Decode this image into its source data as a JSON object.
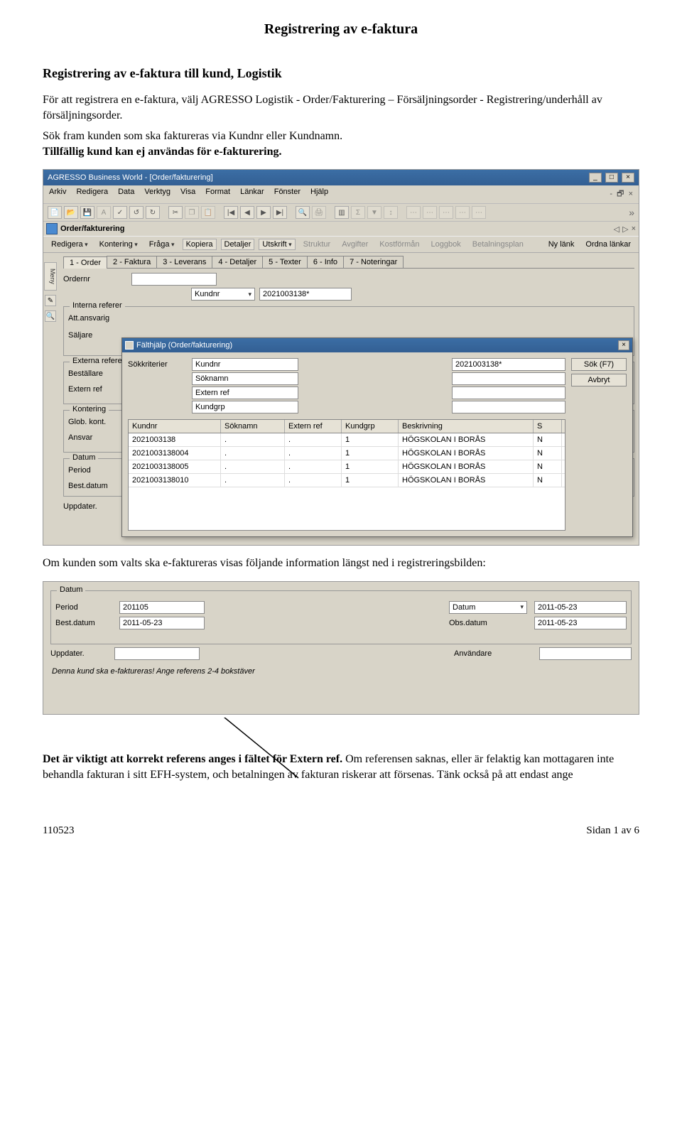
{
  "doc": {
    "title": "Registrering av e-faktura",
    "subtitle": "Registrering av e-faktura till kund, Logistik",
    "para1": "För att registrera en e-faktura, välj AGRESSO Logistik - Order/Fakturering – Försäljningsorder - Registrering/underhåll av försäljningsorder.",
    "para2a": "Sök fram kunden som ska faktureras via Kundnr eller Kundnamn.",
    "para2b": "Tillfällig kund kan ej användas för e-fakturering.",
    "para3": "Om kunden som valts ska e-faktureras visas följande information längst ned i registreringsbilden:",
    "para4": "Det är viktigt att korrekt referens anges i fältet för Extern ref. Om referensen saknas, eller är felaktig kan mottagaren inte behandla fakturan i sitt EFH-system, och betalningen av fakturan riskerar att försenas. Tänk också på att endast ange",
    "footer_left": "110523",
    "footer_right": "Sidan 1 av 6"
  },
  "app": {
    "titlebar": "AGRESSO Business World - [Order/fakturering]",
    "menubar": [
      "Arkiv",
      "Redigera",
      "Data",
      "Verktyg",
      "Visa",
      "Format",
      "Länkar",
      "Fönster",
      "Hjälp"
    ],
    "docbar_title": "Order/fakturering",
    "actions": {
      "redigera": "Redigera",
      "kontering": "Kontering",
      "fraga": "Fråga",
      "kopiera": "Kopiera",
      "detaljer": "Detaljer",
      "utskrift": "Utskrift",
      "struktur": "Struktur",
      "avgifter": "Avgifter",
      "kostforman": "Kostförmån",
      "loggbok": "Loggbok",
      "betalningsplan": "Betalningsplan",
      "nylank": "Ny länk",
      "ordna": "Ordna länkar"
    },
    "tabs": [
      "1 - Order",
      "2 - Faktura",
      "3 - Leverans",
      "4 - Detaljer",
      "5 - Texter",
      "6 - Info",
      "7 - Noteringar"
    ],
    "ordernr_label": "Ordernr",
    "kundnr_dd": "Kundnr",
    "kundnr_value": "2021003138*",
    "left_labels": {
      "interna": "Interna referer",
      "att": "Att.ansvarig",
      "saljare": "Säljare",
      "externa": "Externa referer",
      "bestallare": "Beställare",
      "externref": "Extern ref",
      "kontering": "Kontering",
      "globkont": "Glob. kont.",
      "ansvar": "Ansvar",
      "datum": "Datum",
      "period": "Period",
      "bestdatum": "Best.datum",
      "uppdater": "Uppdater."
    },
    "dialog": {
      "title": "Fälthjälp (Order/fakturering)",
      "sokkriterier": "Sökkriterier",
      "criteria": [
        {
          "label": "Kundnr",
          "value": "2021003138*"
        },
        {
          "label": "Söknamn",
          "value": ""
        },
        {
          "label": "Extern ref",
          "value": ""
        },
        {
          "label": "Kundgrp",
          "value": ""
        }
      ],
      "buttons": {
        "sok": "Sök (F7)",
        "avbryt": "Avbryt"
      },
      "columns": [
        "Kundnr",
        "Söknamn",
        "Extern ref",
        "Kundgrp",
        "Beskrivning",
        "S"
      ],
      "rows": [
        {
          "kundnr": "2021003138",
          "soknamn": ".",
          "extern": ".",
          "grp": "1",
          "besk": "HÖGSKOLAN I BORÅS",
          "s": "N"
        },
        {
          "kundnr": "2021003138004",
          "soknamn": ".",
          "extern": ".",
          "grp": "1",
          "besk": "HÖGSKOLAN I BORÅS",
          "s": "N"
        },
        {
          "kundnr": "2021003138005",
          "soknamn": ".",
          "extern": ".",
          "grp": "1",
          "besk": "HÖGSKOLAN I BORÅS",
          "s": "N"
        },
        {
          "kundnr": "2021003138010",
          "soknamn": ".",
          "extern": ".",
          "grp": "1",
          "besk": "HÖGSKOLAN I BORÅS",
          "s": "N"
        }
      ]
    },
    "shot2": {
      "datum_label": "Datum",
      "period_label": "Period",
      "period_value": "201105",
      "datum_dd": "Datum",
      "datum_value": "2011-05-23",
      "bestdatum_label": "Best.datum",
      "bestdatum_value": "2011-05-23",
      "obsdatum_label": "Obs.datum",
      "obsdatum_value": "2011-05-23",
      "uppdater_label": "Uppdater.",
      "anvandare_label": "Användare",
      "status": "Denna kund ska e-faktureras! Ange referens 2-4 bokstäver"
    }
  }
}
